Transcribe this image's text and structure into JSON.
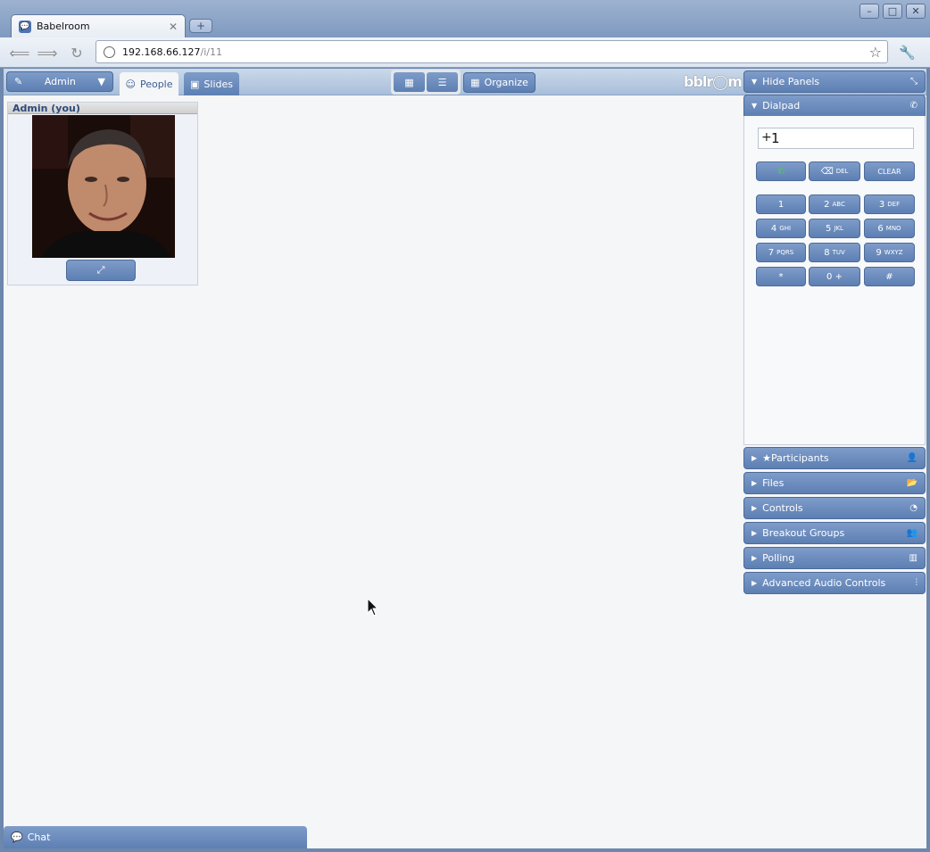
{
  "browser": {
    "tab_title": "Babelroom",
    "url_host": "192.168.66.127",
    "url_path": "/i/11",
    "window_controls": [
      "–",
      "□",
      "✕"
    ]
  },
  "appbar": {
    "admin_menu_label": "Admin",
    "tab_people": "People",
    "tab_slides": "Slides",
    "organize_label": "Organize",
    "logo_text": "bblr◯m"
  },
  "participant": {
    "name": "Admin (you)"
  },
  "panels": {
    "hide_panels": "Hide Panels",
    "dialpad": "Dialpad",
    "participants": "Participants",
    "files": "Files",
    "controls": "Controls",
    "breakout_groups": "Breakout Groups",
    "polling": "Polling",
    "advanced_audio": "Advanced Audio Controls"
  },
  "dialpad": {
    "prefix": "+",
    "value": "1",
    "del_label": "DEL",
    "clear_label": "CLEAR",
    "keys": [
      {
        "main": "1",
        "sub": ""
      },
      {
        "main": "2",
        "sub": "ABC"
      },
      {
        "main": "3",
        "sub": "DEF"
      },
      {
        "main": "4",
        "sub": "GHI"
      },
      {
        "main": "5",
        "sub": "JKL"
      },
      {
        "main": "6",
        "sub": "MNO"
      },
      {
        "main": "7",
        "sub": "PQRS"
      },
      {
        "main": "8",
        "sub": "TUV"
      },
      {
        "main": "9",
        "sub": "WXYZ"
      },
      {
        "main": "*",
        "sub": ""
      },
      {
        "main": "0 +",
        "sub": ""
      },
      {
        "main": "#",
        "sub": ""
      }
    ]
  },
  "chat": {
    "label": "Chat"
  }
}
